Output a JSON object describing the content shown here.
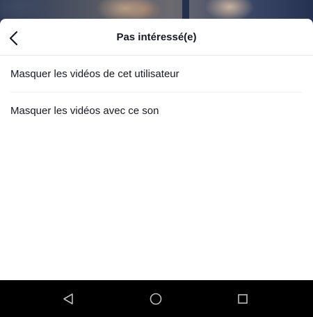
{
  "sheet": {
    "title": "Pas intéressé(e)",
    "back_icon": "chevron-left-icon"
  },
  "options": [
    {
      "label": "Masquer les vidéos de cet utilisateur"
    },
    {
      "label": "Masquer les vidéos avec ce son"
    }
  ],
  "navbar": {
    "back_icon": "triangle-back-icon",
    "home_icon": "circle-home-icon",
    "recents_icon": "square-recents-icon"
  },
  "colors": {
    "text": "#161823",
    "sheet_background": "#ffffff",
    "navbar_background": "#000000",
    "divider": "#e5e5e5",
    "navbar_icon": "#bdbdbd"
  }
}
